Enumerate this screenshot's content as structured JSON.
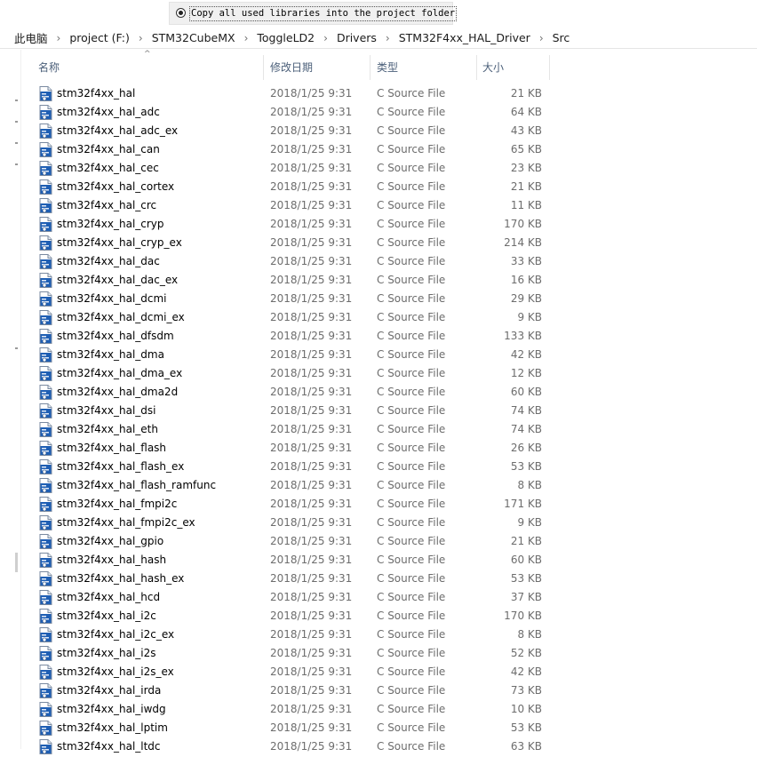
{
  "option": {
    "label": "Copy all used libraries into the project folder"
  },
  "breadcrumb": [
    "此电脑",
    "project (F:)",
    "STM32CubeMX",
    "ToggleLD2",
    "Drivers",
    "STM32F4xx_HAL_Driver",
    "Src"
  ],
  "breadcrumb_separator": "›",
  "columns": {
    "name": "名称",
    "date": "修改日期",
    "type": "类型",
    "size": "大小"
  },
  "sort_indicator": "^",
  "files": [
    {
      "name": "stm32f4xx_hal",
      "date": "2018/1/25 9:31",
      "type": "C Source File",
      "size": "21 KB"
    },
    {
      "name": "stm32f4xx_hal_adc",
      "date": "2018/1/25 9:31",
      "type": "C Source File",
      "size": "64 KB"
    },
    {
      "name": "stm32f4xx_hal_adc_ex",
      "date": "2018/1/25 9:31",
      "type": "C Source File",
      "size": "43 KB"
    },
    {
      "name": "stm32f4xx_hal_can",
      "date": "2018/1/25 9:31",
      "type": "C Source File",
      "size": "65 KB"
    },
    {
      "name": "stm32f4xx_hal_cec",
      "date": "2018/1/25 9:31",
      "type": "C Source File",
      "size": "23 KB"
    },
    {
      "name": "stm32f4xx_hal_cortex",
      "date": "2018/1/25 9:31",
      "type": "C Source File",
      "size": "21 KB"
    },
    {
      "name": "stm32f4xx_hal_crc",
      "date": "2018/1/25 9:31",
      "type": "C Source File",
      "size": "11 KB"
    },
    {
      "name": "stm32f4xx_hal_cryp",
      "date": "2018/1/25 9:31",
      "type": "C Source File",
      "size": "170 KB"
    },
    {
      "name": "stm32f4xx_hal_cryp_ex",
      "date": "2018/1/25 9:31",
      "type": "C Source File",
      "size": "214 KB"
    },
    {
      "name": "stm32f4xx_hal_dac",
      "date": "2018/1/25 9:31",
      "type": "C Source File",
      "size": "33 KB"
    },
    {
      "name": "stm32f4xx_hal_dac_ex",
      "date": "2018/1/25 9:31",
      "type": "C Source File",
      "size": "16 KB"
    },
    {
      "name": "stm32f4xx_hal_dcmi",
      "date": "2018/1/25 9:31",
      "type": "C Source File",
      "size": "29 KB"
    },
    {
      "name": "stm32f4xx_hal_dcmi_ex",
      "date": "2018/1/25 9:31",
      "type": "C Source File",
      "size": "9 KB"
    },
    {
      "name": "stm32f4xx_hal_dfsdm",
      "date": "2018/1/25 9:31",
      "type": "C Source File",
      "size": "133 KB"
    },
    {
      "name": "stm32f4xx_hal_dma",
      "date": "2018/1/25 9:31",
      "type": "C Source File",
      "size": "42 KB"
    },
    {
      "name": "stm32f4xx_hal_dma_ex",
      "date": "2018/1/25 9:31",
      "type": "C Source File",
      "size": "12 KB"
    },
    {
      "name": "stm32f4xx_hal_dma2d",
      "date": "2018/1/25 9:31",
      "type": "C Source File",
      "size": "60 KB"
    },
    {
      "name": "stm32f4xx_hal_dsi",
      "date": "2018/1/25 9:31",
      "type": "C Source File",
      "size": "74 KB"
    },
    {
      "name": "stm32f4xx_hal_eth",
      "date": "2018/1/25 9:31",
      "type": "C Source File",
      "size": "74 KB"
    },
    {
      "name": "stm32f4xx_hal_flash",
      "date": "2018/1/25 9:31",
      "type": "C Source File",
      "size": "26 KB"
    },
    {
      "name": "stm32f4xx_hal_flash_ex",
      "date": "2018/1/25 9:31",
      "type": "C Source File",
      "size": "53 KB"
    },
    {
      "name": "stm32f4xx_hal_flash_ramfunc",
      "date": "2018/1/25 9:31",
      "type": "C Source File",
      "size": "8 KB"
    },
    {
      "name": "stm32f4xx_hal_fmpi2c",
      "date": "2018/1/25 9:31",
      "type": "C Source File",
      "size": "171 KB"
    },
    {
      "name": "stm32f4xx_hal_fmpi2c_ex",
      "date": "2018/1/25 9:31",
      "type": "C Source File",
      "size": "9 KB"
    },
    {
      "name": "stm32f4xx_hal_gpio",
      "date": "2018/1/25 9:31",
      "type": "C Source File",
      "size": "21 KB"
    },
    {
      "name": "stm32f4xx_hal_hash",
      "date": "2018/1/25 9:31",
      "type": "C Source File",
      "size": "60 KB"
    },
    {
      "name": "stm32f4xx_hal_hash_ex",
      "date": "2018/1/25 9:31",
      "type": "C Source File",
      "size": "53 KB"
    },
    {
      "name": "stm32f4xx_hal_hcd",
      "date": "2018/1/25 9:31",
      "type": "C Source File",
      "size": "37 KB"
    },
    {
      "name": "stm32f4xx_hal_i2c",
      "date": "2018/1/25 9:31",
      "type": "C Source File",
      "size": "170 KB"
    },
    {
      "name": "stm32f4xx_hal_i2c_ex",
      "date": "2018/1/25 9:31",
      "type": "C Source File",
      "size": "8 KB"
    },
    {
      "name": "stm32f4xx_hal_i2s",
      "date": "2018/1/25 9:31",
      "type": "C Source File",
      "size": "52 KB"
    },
    {
      "name": "stm32f4xx_hal_i2s_ex",
      "date": "2018/1/25 9:31",
      "type": "C Source File",
      "size": "42 KB"
    },
    {
      "name": "stm32f4xx_hal_irda",
      "date": "2018/1/25 9:31",
      "type": "C Source File",
      "size": "73 KB"
    },
    {
      "name": "stm32f4xx_hal_iwdg",
      "date": "2018/1/25 9:31",
      "type": "C Source File",
      "size": "10 KB"
    },
    {
      "name": "stm32f4xx_hal_lptim",
      "date": "2018/1/25 9:31",
      "type": "C Source File",
      "size": "53 KB"
    },
    {
      "name": "stm32f4xx_hal_ltdc",
      "date": "2018/1/25 9:31",
      "type": "C Source File",
      "size": "63 KB"
    }
  ],
  "icons": {
    "file": "c-source-file-icon",
    "radio": "radio-selected-icon"
  },
  "colors": {
    "header_text": "#4c607a",
    "secondary_text": "#6d6d6d",
    "icon_blue": "#1f5fb4"
  }
}
